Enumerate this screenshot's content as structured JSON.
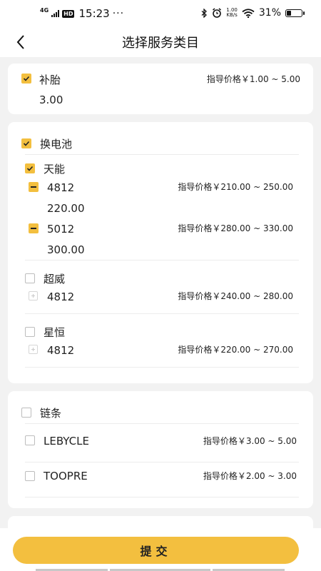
{
  "status": {
    "network": "4G",
    "hd": "HD",
    "time": "15:23",
    "dots": "···",
    "speed_value": "1.00",
    "speed_unit": "KB/s",
    "battery_text": "31%",
    "battery_level": 0.31
  },
  "nav": {
    "title": "选择服务类目"
  },
  "groups": [
    {
      "label": "补胎",
      "price": "指导价格￥1.00 ~ 5.00",
      "value": "3.00"
    },
    {
      "label": "换电池",
      "brands": [
        {
          "label": "天能",
          "items": [
            {
              "label": "4812",
              "price": "指导价格￥210.00 ~ 250.00",
              "value": "220.00"
            },
            {
              "label": "5012",
              "price": "指导价格￥280.00 ~ 330.00",
              "value": "300.00"
            }
          ]
        },
        {
          "label": "超威",
          "items": [
            {
              "label": "4812",
              "price": "指导价格￥240.00 ~ 280.00"
            }
          ]
        },
        {
          "label": "星恒",
          "items": [
            {
              "label": "4812",
              "price": "指导价格￥220.00 ~ 270.00"
            }
          ]
        }
      ]
    },
    {
      "label": "链条",
      "items": [
        {
          "label": "LEBYCLE",
          "price": "指导价格￥3.00 ~ 5.00"
        },
        {
          "label": "TOOPRE",
          "price": "指导价格￥2.00 ~ 3.00"
        }
      ]
    }
  ],
  "submit_label": "提交",
  "colors": {
    "accent": "#f3bf3f",
    "background": "#f2f2f2",
    "card": "#ffffff"
  }
}
